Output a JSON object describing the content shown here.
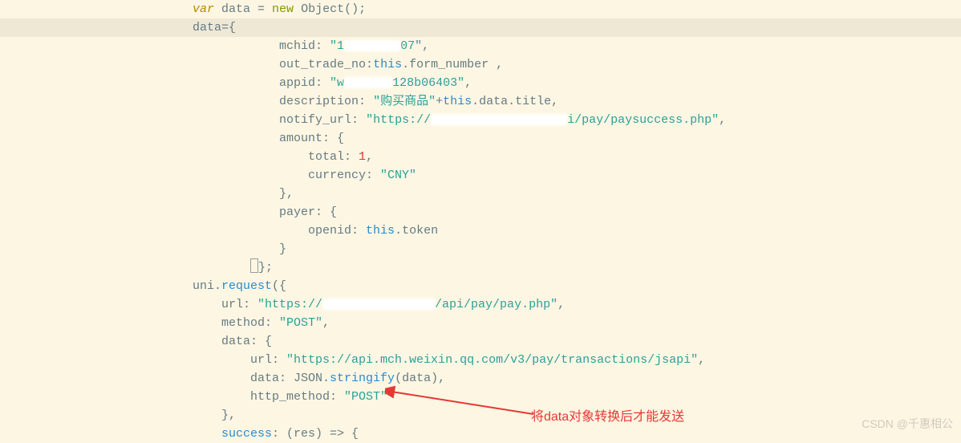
{
  "code": {
    "line1_var": "var",
    "line1_data": " data ",
    "line1_eq": "= ",
    "line1_new": "new",
    "line1_obj": " Object",
    "line1_paren": "();",
    "line2_data": "data",
    "line2_eq": "=",
    "line2_brace": "{",
    "mchid_key": "mchid: ",
    "mchid_val_a": "\"1",
    "mchid_val_b": "07\"",
    "mchid_comma": ",",
    "outtrade_key": "out_trade_no:",
    "outtrade_this": "this",
    "outtrade_prop": ".form_number ,",
    "appid_key": "appid: ",
    "appid_val_a": "\"w",
    "appid_val_mid": "128b",
    "appid_val_b": "06403\"",
    "appid_comma": ",",
    "desc_key": "description: ",
    "desc_val": "\"购买商品\"",
    "desc_plus": "+",
    "desc_this": "this",
    "desc_rest": ".data.title,",
    "notify_key": "notify_url: ",
    "notify_val_a": "\"https://",
    "notify_val_b": "i/pay/paysuccess.php\"",
    "notify_comma": ",",
    "amount_key": "amount: {",
    "total_key": "total: ",
    "total_val": "1",
    "total_comma": ",",
    "currency_key": "currency: ",
    "currency_val": "\"CNY\"",
    "amount_close": "},",
    "payer_key": "payer: {",
    "openid_key": "openid: ",
    "openid_this": "this",
    "openid_prop": ".token",
    "payer_close": "}",
    "obj_close": "};",
    "req_uni": "uni.",
    "req_method": "request",
    "req_open": "({",
    "url_key": "url: ",
    "url_val_a": "\"https://",
    "url_val_b": "/api/pay/pay.php\"",
    "url_comma": ",",
    "method_key": "method: ",
    "method_val": "\"POST\"",
    "method_comma": ",",
    "data_key": "data: {",
    "inner_url_key": "url: ",
    "inner_url_val": "\"https://api.mch.weixin.qq.com/v3/pay/transactions/jsapi\"",
    "inner_url_comma": ",",
    "inner_data_key": "data: JSON.",
    "inner_data_method": "stringify",
    "inner_data_rest": "(data),",
    "http_key": "http_method: ",
    "http_val": "\"POST\"",
    "data_close": "},",
    "success_key": "success",
    "success_rest": ": (res) => {"
  },
  "annotation": "将data对象转换后才能发送",
  "watermark": "CSDN @千惠相公"
}
